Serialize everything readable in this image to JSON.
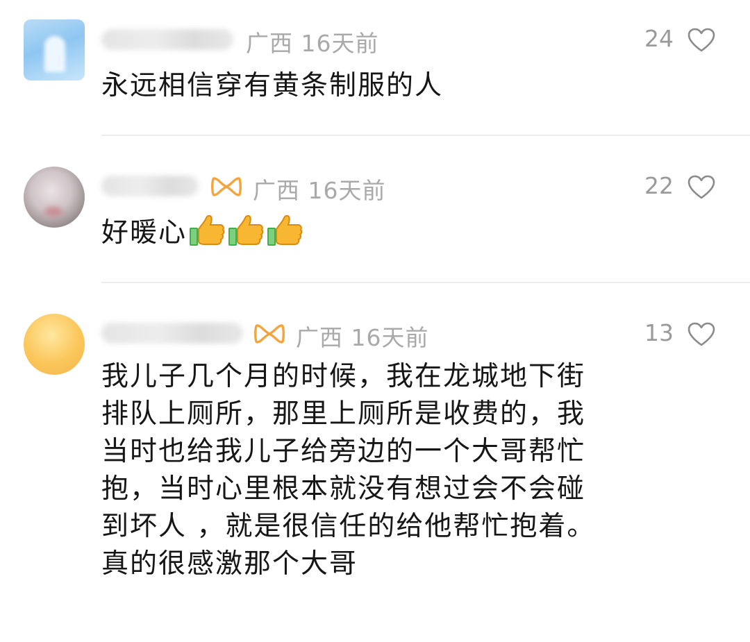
{
  "comments": [
    {
      "location_time": "广西 16天前",
      "likes": "24",
      "text_lines": [
        "永远相信穿有黄条制服的人"
      ],
      "has_vip_badge": false,
      "emojis": []
    },
    {
      "location_time": "广西 16天前",
      "likes": "22",
      "text_lines": [
        "好暖心"
      ],
      "has_vip_badge": true,
      "emojis": [
        "thumbs-up",
        "thumbs-up",
        "thumbs-up"
      ]
    },
    {
      "location_time": "广西 16天前",
      "likes": "13",
      "text_lines": [
        "我儿子几个月的时候，我在龙城地下街",
        "排队上厕所，那里上厕所是收费的，我",
        "当时也给我儿子给旁边的一个大哥帮忙",
        "抱，当时心里根本就没有想过会不会碰",
        "到坏人 ，就是很信任的给他帮忙抱着。",
        "真的很感激那个大哥"
      ],
      "has_vip_badge": true,
      "emojis": []
    }
  ],
  "colors": {
    "meta_text": "#a9a9a9",
    "vip_badge": "#f5a43c",
    "divider": "#ececec"
  }
}
